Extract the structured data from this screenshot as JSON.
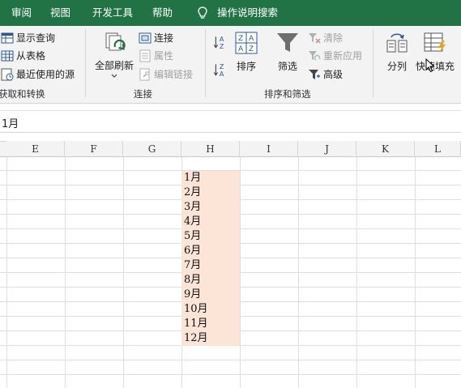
{
  "tabs": [
    {
      "label": "审阅"
    },
    {
      "label": "视图"
    },
    {
      "label": "开发工具"
    },
    {
      "label": "帮助"
    }
  ],
  "tell_me": {
    "label": "操作说明搜索",
    "icon": "lightbulb-icon"
  },
  "ribbon": {
    "get_transform": {
      "items": [
        {
          "label": "显示查询",
          "icon": "table-query-icon"
        },
        {
          "label": "从表格",
          "icon": "table-icon"
        },
        {
          "label": "最近使用的源",
          "icon": "recent-source-icon"
        }
      ],
      "group_label": "获取和转换"
    },
    "connections": {
      "refresh_all": "全部刷新",
      "items": [
        {
          "label": "连接",
          "icon": "connections-icon",
          "enabled": true
        },
        {
          "label": "属性",
          "icon": "properties-icon",
          "enabled": false
        },
        {
          "label": "编辑链接",
          "icon": "edit-links-icon",
          "enabled": false
        }
      ],
      "group_label": "连接"
    },
    "sort_filter": {
      "sort": "排序",
      "filter": "筛选",
      "clear": "清除",
      "reapply": "重新应用",
      "advanced": "高级",
      "group_label": "排序和筛选"
    },
    "data_tools": {
      "text_to_columns": "分列",
      "flash_fill": "快速填充"
    }
  },
  "formula_bar": {
    "value": "1月"
  },
  "columns": [
    "E",
    "F",
    "G",
    "H",
    "I",
    "J",
    "K",
    "L"
  ],
  "cells_h": [
    "1月",
    "2月",
    "3月",
    "4月",
    "5月",
    "6月",
    "7月",
    "8月",
    "9月",
    "10月",
    "11月",
    "12月"
  ],
  "colors": {
    "accent": "#217346",
    "cell_fill": "#fce4d6"
  }
}
